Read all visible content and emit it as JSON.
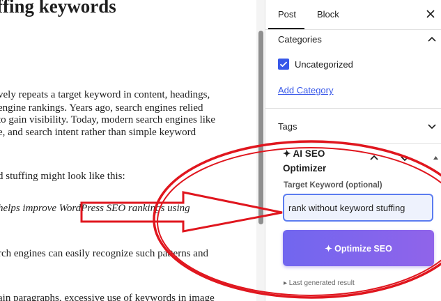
{
  "editor": {
    "heading": "ffing keywords",
    "lines": [
      {
        "text": "vely repeats a target keyword in content, headings,",
        "italic": false
      },
      {
        "text": "engine rankings. Years ago, search engines relied",
        "italic": false
      },
      {
        "text": "to gain visibility. Today, modern search engines like",
        "italic": false
      },
      {
        "text": "e, and search intent rather than simple keyword",
        "italic": false
      },
      {
        "text": "d stuffing might look like this:",
        "italic": false
      },
      {
        "text": " helps improve WordPress SEO rankings using",
        "italic": true
      },
      {
        "text": "rch engines can easily recognize such patterns and",
        "italic": false
      },
      {
        "text": "ain paragraphs, excessive use of keywords in image",
        "italic": false
      }
    ]
  },
  "sidebar": {
    "tabs": [
      "Post",
      "Block"
    ],
    "active_tab": "Post",
    "categories": {
      "title": "Categories",
      "items": [
        {
          "label": "Uncategorized",
          "checked": true
        }
      ],
      "add_link": "Add Category"
    },
    "tags": {
      "title": "Tags"
    },
    "ai_seo": {
      "title_line1": "✦ AI SEO",
      "title_line2": "Optimizer",
      "keyword_label": "Target Keyword (optional)",
      "keyword_value": "rank without keyword stuffing",
      "button_label": "✦ Optimize SEO",
      "last_generated": "▸ Last generated result"
    }
  },
  "colors": {
    "accent": "#3858e9",
    "button_gradient_start": "#7166ef",
    "button_gradient_end": "#9064ea",
    "annotation_red": "#e0161e"
  },
  "icons": [
    "close-icon",
    "chevron-up-icon",
    "chevron-down-icon",
    "checkmark-icon",
    "arrow-annotation",
    "ellipse-annotation"
  ]
}
